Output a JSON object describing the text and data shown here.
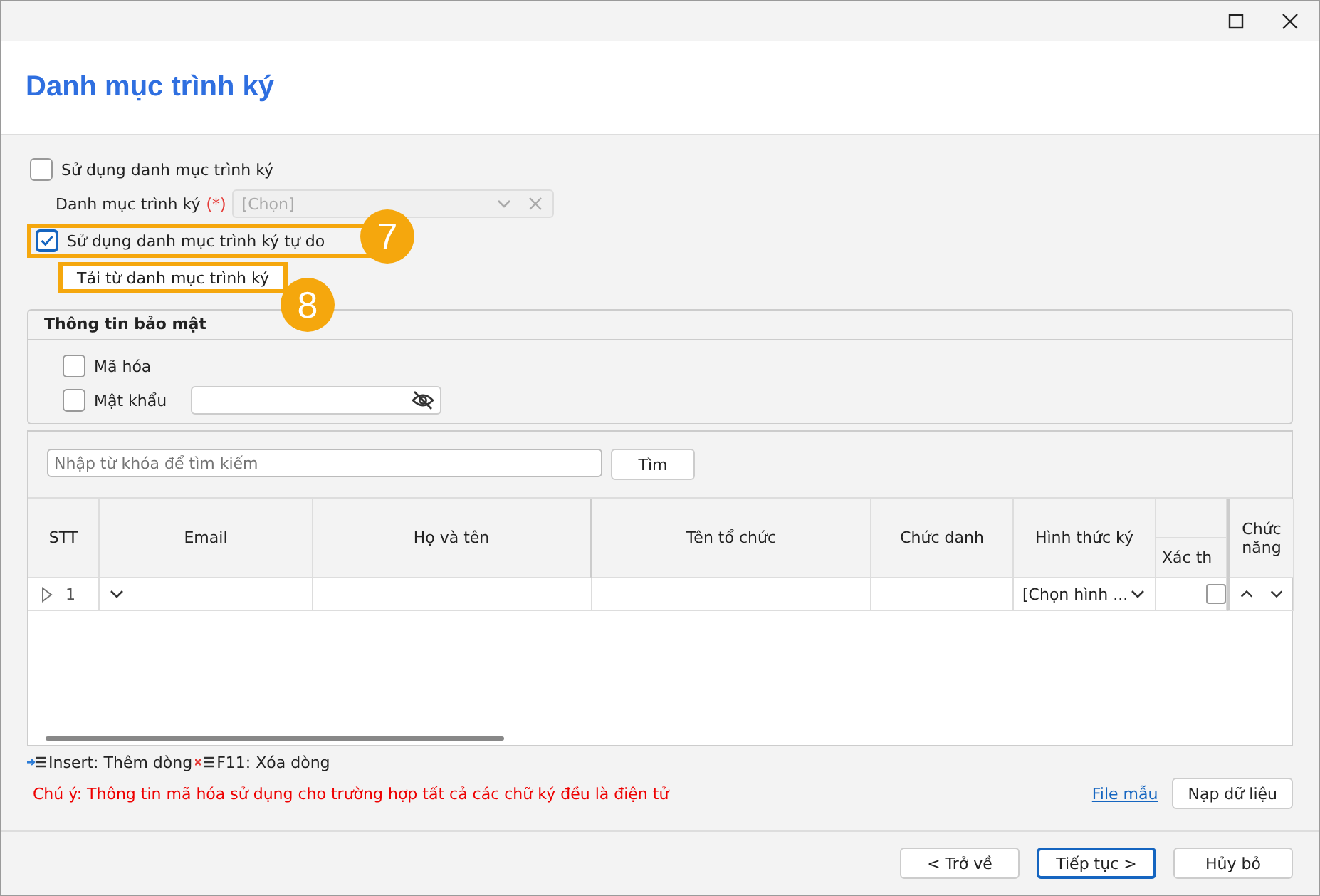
{
  "window": {
    "title": "Danh mục trình ký"
  },
  "use_catalog": {
    "label": "Sử dụng danh mục trình ký",
    "checked": false
  },
  "catalog_field": {
    "label": "Danh mục trình ký",
    "required_mark": "(*)",
    "placeholder": "[Chọn]"
  },
  "use_free": {
    "label": "Sử dụng danh mục trình ký tự do",
    "checked": true
  },
  "load_button": "Tải từ danh mục trình ký",
  "callouts": [
    {
      "number": "7"
    },
    {
      "number": "8"
    }
  ],
  "security": {
    "title": "Thông tin bảo mật",
    "options": [
      {
        "label": "Mã hóa",
        "checked": false,
        "kind": "checkbox"
      },
      {
        "label": "Mật khẩu",
        "checked": false,
        "kind": "password"
      }
    ]
  },
  "search": {
    "placeholder": "Nhập từ khóa để tìm kiếm",
    "button": "Tìm"
  },
  "table": {
    "columns": [
      "STT",
      "Email",
      "Họ và tên",
      "Tên tổ chức",
      "Chức danh",
      "Hình thức ký",
      "Xác th",
      "Chức năng"
    ],
    "rows": [
      {
        "stt": "1",
        "sign_type": "[Chọn hình ...",
        "confirmed": false
      }
    ]
  },
  "hints": [
    {
      "text": "Insert: Thêm dòng",
      "kind": "add"
    },
    {
      "text": "F11: Xóa dòng",
      "kind": "delete"
    }
  ],
  "note": "Chú ý: Thông tin mã hóa sử dụng cho trường hợp tất cả các chữ ký đều là điện tử",
  "sample_link": "File mẫu",
  "import_button": "Nạp dữ liệu",
  "footer_buttons": [
    {
      "label": "< Trở về",
      "selected": false
    },
    {
      "label": "Tiếp tục >",
      "selected": true
    },
    {
      "label": "Hủy bỏ",
      "selected": false
    }
  ]
}
